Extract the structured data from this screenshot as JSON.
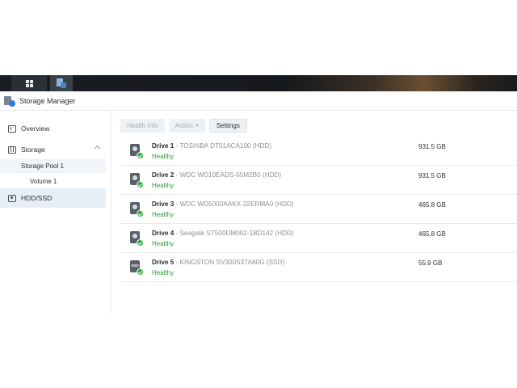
{
  "window": {
    "title": "Storage Manager"
  },
  "sidebar": {
    "items": [
      {
        "label": "Overview"
      },
      {
        "label": "Storage"
      },
      {
        "label": "Storage Pool 1"
      },
      {
        "label": "Volume 1"
      },
      {
        "label": "HDD/SSD"
      }
    ]
  },
  "toolbar": {
    "health_info": "Health Info",
    "action": "Action",
    "settings": "Settings"
  },
  "drives": [
    {
      "name": "Drive 1",
      "sep": " - ",
      "model": "TOSHIBA DT01ACA100 (HDD)",
      "status": "Healthy",
      "capacity": "931.5 GB",
      "type": "HDD"
    },
    {
      "name": "Drive 2",
      "sep": " - ",
      "model": "WDC WD10EADS-65M2B0 (HDD)",
      "status": "Healthy",
      "capacity": "931.5 GB",
      "type": "HDD"
    },
    {
      "name": "Drive 3",
      "sep": " - ",
      "model": "WDC WD5000AAKX-22ERMA0 (HDD)",
      "status": "Healthy",
      "capacity": "465.8 GB",
      "type": "HDD"
    },
    {
      "name": "Drive 4",
      "sep": " - ",
      "model": "Seagate ST500DM002-1BD142 (HDD)",
      "status": "Healthy",
      "capacity": "465.8 GB",
      "type": "HDD"
    },
    {
      "name": "Drive 5",
      "sep": " - ",
      "model": "KINGSTON SV300S37A60G (SSD)",
      "status": "Healthy",
      "capacity": "55.9 GB",
      "type": "SSD",
      "icon_text": "SSD"
    }
  ],
  "colors": {
    "healthy": "#2aa12f",
    "accent": "#2f7fd4"
  },
  "icons": {
    "taskbar_main": "grid-icon",
    "taskbar_app": "storage-manager-icon"
  }
}
